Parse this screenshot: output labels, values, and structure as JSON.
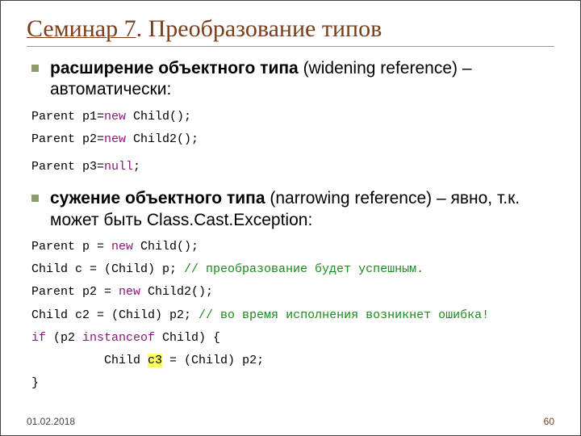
{
  "title": {
    "underlined": "Семинар 7",
    "rest": ". Преобразование типов"
  },
  "bullet1": {
    "bold": "расширение объектного типа",
    "rest": " (widening reference) – автоматически:"
  },
  "code1a": {
    "p1": "Parent p1=",
    "kw": "new",
    "p2": " Child();"
  },
  "code1b": {
    "p1": "Parent p2=",
    "kw": "new",
    "p2": " Child2();"
  },
  "code1c": {
    "p1": "Parent p3=",
    "kw": "null",
    "p2": ";"
  },
  "bullet2": {
    "bold": "сужение объектного типа",
    "rest": " (narrowing reference) – явно, т.к. может быть Class.Cast.Exception:"
  },
  "code2a": {
    "p1": "Parent p = ",
    "kw": "new",
    "p2": " Child();"
  },
  "code2b": {
    "p1": "Child c = (Child) p; ",
    "cm": "// преобразование будет успешным."
  },
  "code2c": {
    "p1": "Parent p2 = ",
    "kw": "new",
    "p2": " Child2();"
  },
  "code2d": {
    "p1": "Child c2 = (Child) p2; ",
    "cm": "// во время исполнения возникнет ошибка!"
  },
  "code2e": {
    "kw1": "if",
    "p1": " (p2 ",
    "kw2": "instanceof",
    "p2": " Child) {"
  },
  "code2f": {
    "p1": "          Child ",
    "hl": "c3",
    "p2": " = (Child) p2;"
  },
  "code2g": {
    "p1": "}"
  },
  "footer": {
    "date": "01.02.2018",
    "page": "60"
  }
}
